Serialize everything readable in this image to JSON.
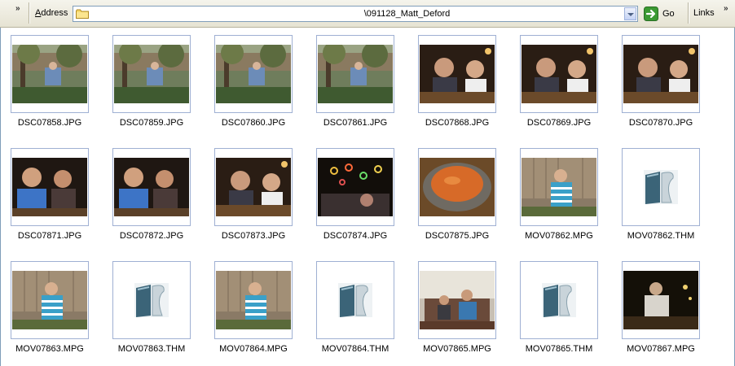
{
  "addressbar": {
    "address_label_prefix": "A",
    "address_label_rest": "ddress",
    "path": "\\091128_Matt_Deford",
    "go_label": "Go",
    "links_label": "Links"
  },
  "files": [
    {
      "name": "DSC07858.JPG",
      "kind": "photo",
      "scene": "yard"
    },
    {
      "name": "DSC07859.JPG",
      "kind": "photo",
      "scene": "yard"
    },
    {
      "name": "DSC07860.JPG",
      "kind": "photo",
      "scene": "yard"
    },
    {
      "name": "DSC07861.JPG",
      "kind": "photo",
      "scene": "yard"
    },
    {
      "name": "DSC07868.JPG",
      "kind": "photo",
      "scene": "dinner"
    },
    {
      "name": "DSC07869.JPG",
      "kind": "photo",
      "scene": "dinner"
    },
    {
      "name": "DSC07870.JPG",
      "kind": "photo",
      "scene": "dinner"
    },
    {
      "name": "DSC07871.JPG",
      "kind": "photo",
      "scene": "dinner-blue"
    },
    {
      "name": "DSC07872.JPG",
      "kind": "photo",
      "scene": "dinner-blue"
    },
    {
      "name": "DSC07873.JPG",
      "kind": "photo",
      "scene": "dinner"
    },
    {
      "name": "DSC07874.JPG",
      "kind": "photo",
      "scene": "lights"
    },
    {
      "name": "DSC07875.JPG",
      "kind": "photo",
      "scene": "salsa"
    },
    {
      "name": "MOV07862.MPG",
      "kind": "photo",
      "scene": "fence"
    },
    {
      "name": "MOV07862.THM",
      "kind": "generic",
      "scene": ""
    },
    {
      "name": "MOV07863.MPG",
      "kind": "photo",
      "scene": "fence"
    },
    {
      "name": "MOV07863.THM",
      "kind": "generic",
      "scene": ""
    },
    {
      "name": "MOV07864.MPG",
      "kind": "photo",
      "scene": "fence"
    },
    {
      "name": "MOV07864.THM",
      "kind": "generic",
      "scene": ""
    },
    {
      "name": "MOV07865.MPG",
      "kind": "photo",
      "scene": "room"
    },
    {
      "name": "MOV07865.THM",
      "kind": "generic",
      "scene": ""
    },
    {
      "name": "MOV07867.MPG",
      "kind": "photo",
      "scene": "dark"
    }
  ],
  "colors": {
    "thumb_border": "#9fb0d3",
    "addr_border": "#7f9db9",
    "go_green": "#3b9a33"
  }
}
